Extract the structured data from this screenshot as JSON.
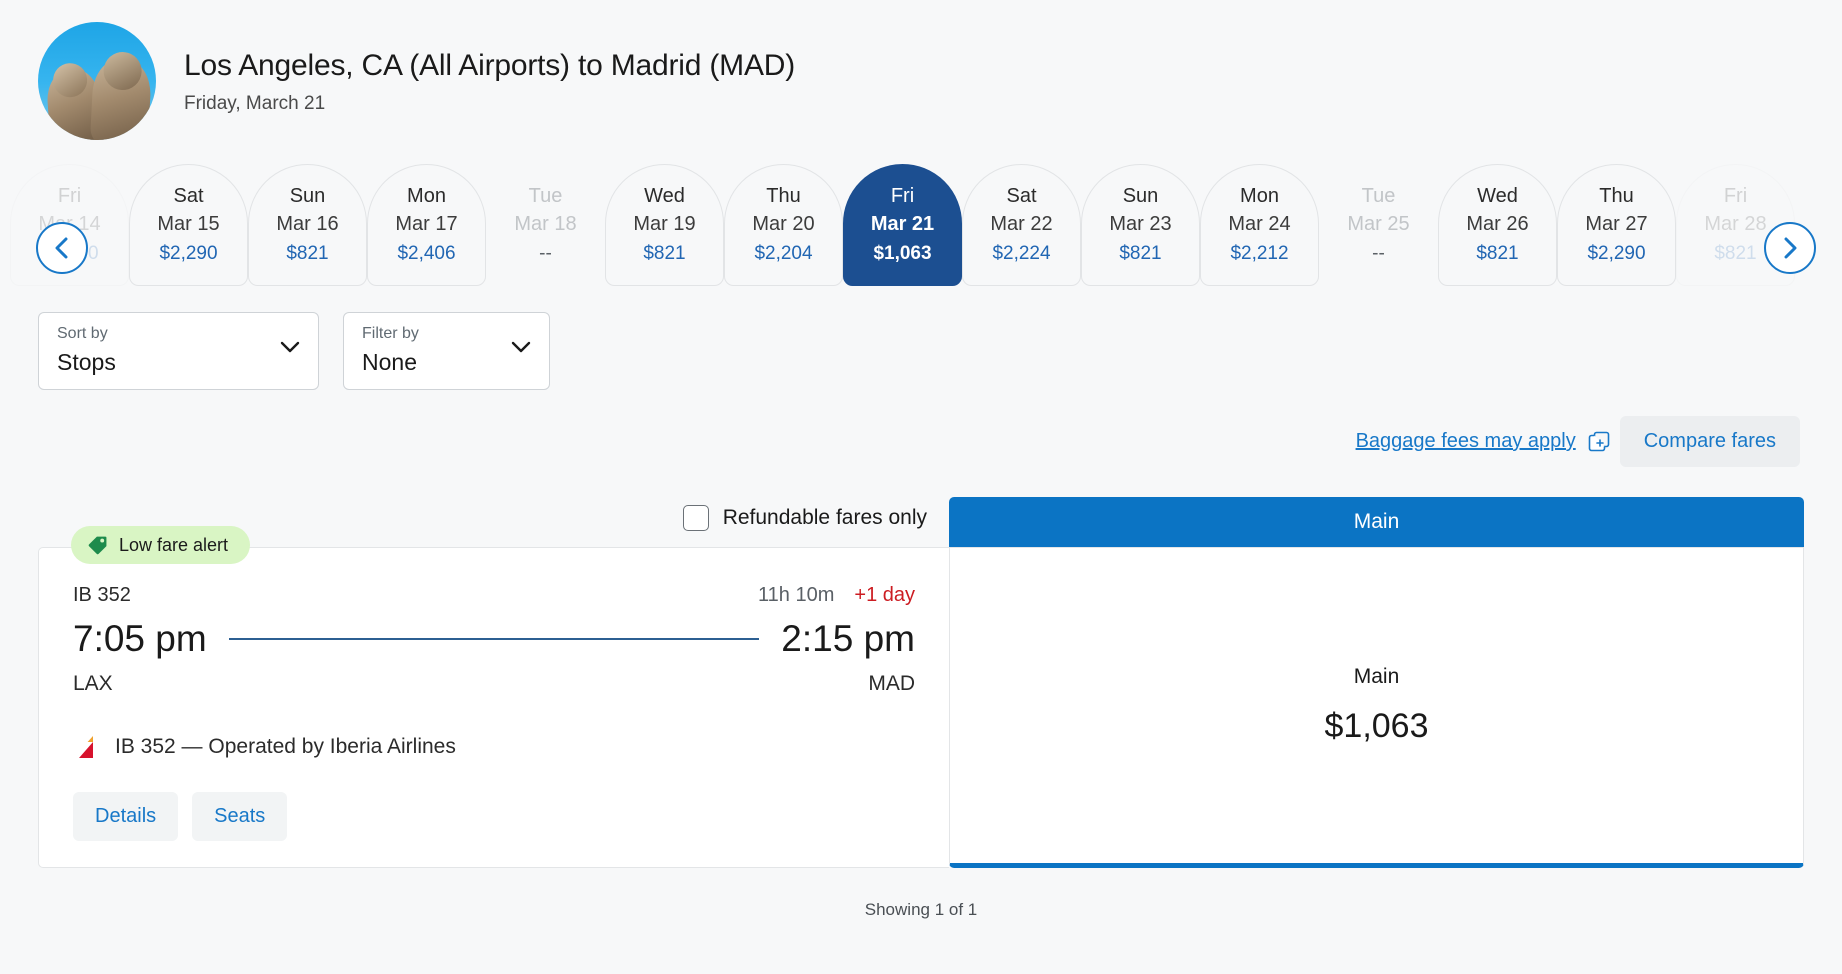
{
  "header": {
    "avatar_alt": "madrid-lion-statues",
    "route_title": "Los Angeles, CA (All Airports) to Madrid (MAD)",
    "route_date": "Friday, March 21"
  },
  "date_strip": {
    "prev_label": "‹",
    "next_label": "›",
    "days": [
      {
        "dow": "Fri",
        "dom": "Mar 14",
        "price": "$2,290",
        "state": "ghost"
      },
      {
        "dow": "Sat",
        "dom": "Mar 15",
        "price": "$2,290",
        "state": "normal"
      },
      {
        "dow": "Sun",
        "dom": "Mar 16",
        "price": "$821",
        "state": "normal"
      },
      {
        "dow": "Mon",
        "dom": "Mar 17",
        "price": "$2,406",
        "state": "normal"
      },
      {
        "dow": "Tue",
        "dom": "Mar 18",
        "price": "--",
        "state": "disabled"
      },
      {
        "dow": "Wed",
        "dom": "Mar 19",
        "price": "$821",
        "state": "normal"
      },
      {
        "dow": "Thu",
        "dom": "Mar 20",
        "price": "$2,204",
        "state": "normal"
      },
      {
        "dow": "Fri",
        "dom": "Mar 21",
        "price": "$1,063",
        "state": "selected"
      },
      {
        "dow": "Sat",
        "dom": "Mar 22",
        "price": "$2,224",
        "state": "normal"
      },
      {
        "dow": "Sun",
        "dom": "Mar 23",
        "price": "$821",
        "state": "normal"
      },
      {
        "dow": "Mon",
        "dom": "Mar 24",
        "price": "$2,212",
        "state": "normal"
      },
      {
        "dow": "Tue",
        "dom": "Mar 25",
        "price": "--",
        "state": "disabled"
      },
      {
        "dow": "Wed",
        "dom": "Mar 26",
        "price": "$821",
        "state": "normal"
      },
      {
        "dow": "Thu",
        "dom": "Mar 27",
        "price": "$2,290",
        "state": "normal"
      },
      {
        "dow": "Fri",
        "dom": "Mar 28",
        "price": "$821",
        "state": "ghost"
      }
    ]
  },
  "controls": {
    "sort": {
      "label": "Sort by",
      "value": "Stops"
    },
    "filter": {
      "label": "Filter by",
      "value": "None"
    }
  },
  "baggage": {
    "link_text": "Baggage fees may apply",
    "icon": "open-in-new-window-icon",
    "compare_label": "Compare fares"
  },
  "results": {
    "refundable_label": "Refundable fares only",
    "refundable_checked": false,
    "fare_column_header": "Main",
    "showing_text": "Showing 1 of 1",
    "flight": {
      "badge_text": "Low fare alert",
      "badge_icon": "price-tag-icon",
      "flight_number": "IB 352",
      "duration": "11h 10m",
      "day_offset": "+1 day",
      "depart_time": "7:05 pm",
      "arrive_time": "2:15 pm",
      "depart_code": "LAX",
      "arrive_code": "MAD",
      "operator_text": "IB 352 — Operated by Iberia Airlines",
      "operator_icon": "iberia-logo-icon",
      "details_label": "Details",
      "seats_label": "Seats"
    },
    "fare": {
      "name": "Main",
      "price": "$1,063"
    }
  },
  "colors": {
    "selected_date_bg": "#1c4f91",
    "fare_header_bg": "#0b74c4",
    "link_blue": "#1878c8",
    "price_blue": "#2166b3",
    "alert_red": "#cc1c22",
    "low_fare_bg": "#d9f5c4",
    "page_bg": "#f7f8f9"
  }
}
